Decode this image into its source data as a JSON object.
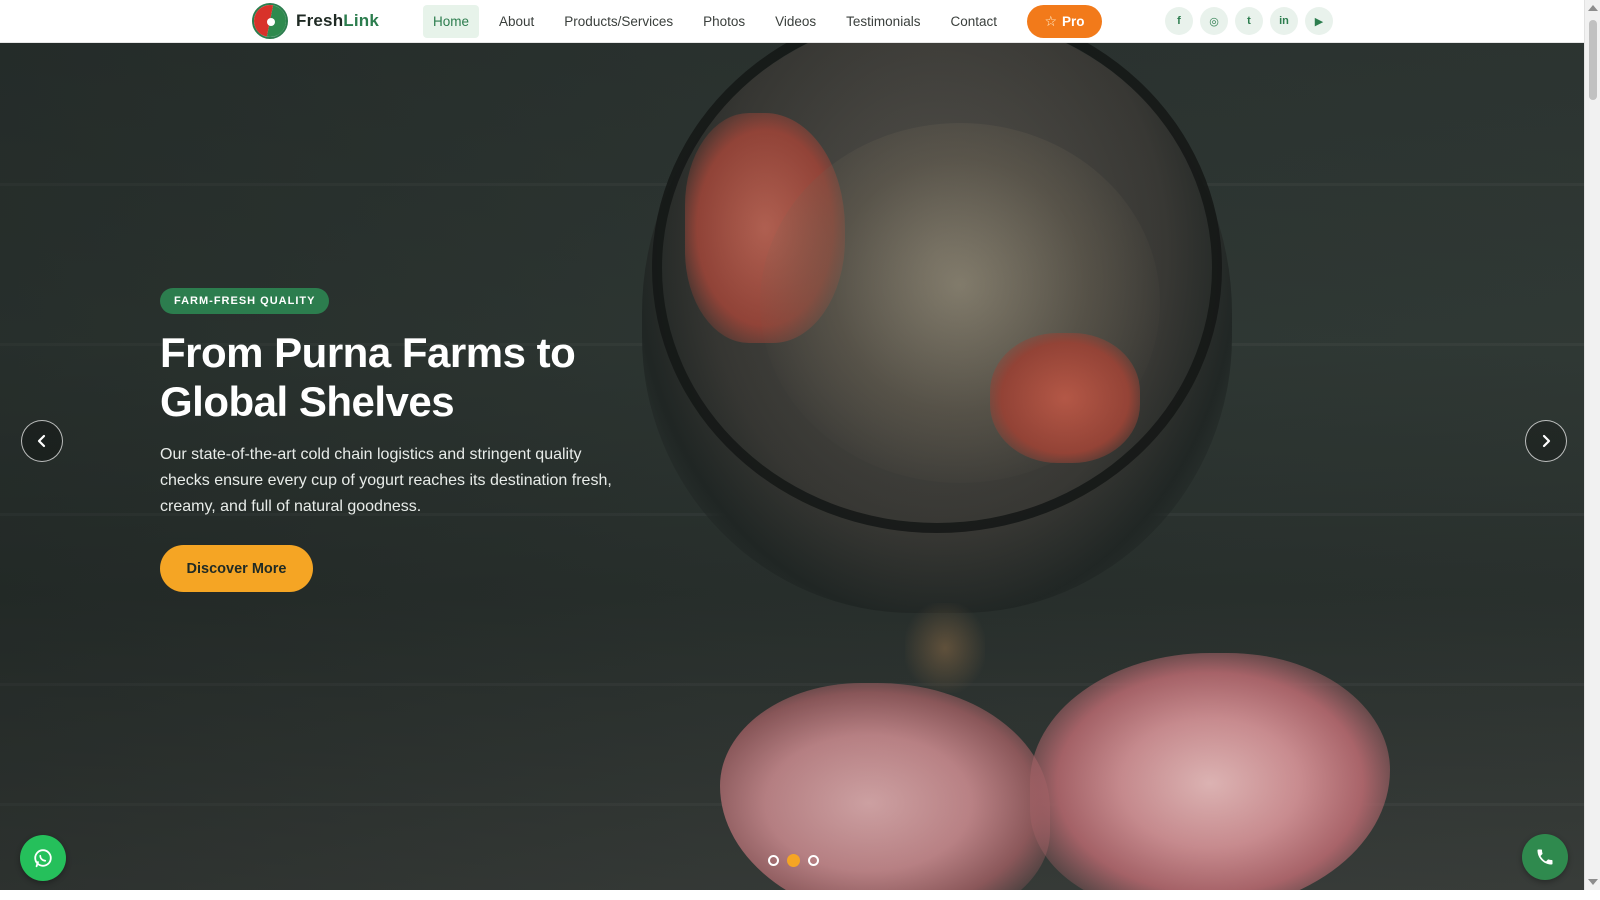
{
  "brand": {
    "name_part1": "Fresh",
    "name_part2": "Link"
  },
  "nav": {
    "items": [
      {
        "label": "Home",
        "active": true
      },
      {
        "label": "About"
      },
      {
        "label": "Products/Services"
      },
      {
        "label": "Photos"
      },
      {
        "label": "Videos"
      },
      {
        "label": "Testimonials"
      },
      {
        "label": "Contact"
      }
    ],
    "pro_label": "Pro",
    "pro_icon": "star-icon"
  },
  "socials": [
    {
      "icon": "facebook-icon",
      "glyph": "f"
    },
    {
      "icon": "instagram-icon",
      "glyph": "◎"
    },
    {
      "icon": "twitter-icon",
      "glyph": "t"
    },
    {
      "icon": "linkedin-icon",
      "glyph": "in"
    },
    {
      "icon": "youtube-icon",
      "glyph": "▶"
    }
  ],
  "hero": {
    "badge": "FARM-FRESH QUALITY",
    "title": "From Purna Farms to Global Shelves",
    "description": "Our state-of-the-art cold chain logistics and stringent quality checks ensure every cup of yogurt reaches its destination fresh, creamy, and full of natural goodness.",
    "cta_label": "Discover More",
    "slide_count": 3,
    "active_slide": 2
  },
  "floating": {
    "left_icon": "whatsapp-icon",
    "right_icon": "phone-icon"
  },
  "colors": {
    "primary_green": "#2c7d4e",
    "accent_orange": "#f27a1a",
    "cta_yellow": "#f5a524",
    "whatsapp_green": "#25c05b"
  }
}
